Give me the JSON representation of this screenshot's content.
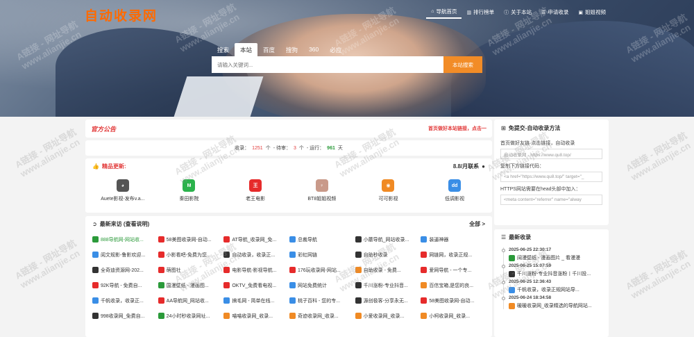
{
  "site": {
    "logo": "自动收录网"
  },
  "topnav": [
    {
      "icon": "home-icon",
      "glyph": "⌂",
      "label": "导航首页",
      "active": true
    },
    {
      "icon": "chart-icon",
      "glyph": "▥",
      "label": "排行榜单"
    },
    {
      "icon": "info-icon",
      "glyph": "ⓘ",
      "label": "关于本站"
    },
    {
      "icon": "feed-icon",
      "glyph": "☰",
      "label": "申请收录"
    },
    {
      "icon": "video-icon",
      "glyph": "▣",
      "label": "姐姐视频"
    }
  ],
  "search": {
    "tabs": [
      "搜索",
      "本站",
      "百度",
      "搜狗",
      "360",
      "必应"
    ],
    "active_tab": 1,
    "placeholder": "请输入关键词...",
    "button": "本站搜索"
  },
  "announcement": {
    "tag": "官方公告",
    "message": "首页做好本站链接，点击一"
  },
  "stats": {
    "label_total": "收录：",
    "total": "1251",
    "unit": "个",
    "label_pending": "- 待审：",
    "pending": "3",
    "unit2": "个",
    "label_days": "- 运行：",
    "days": "961",
    "unit3": "天"
  },
  "featured": {
    "title": "精品更新:",
    "right": "8.8/月联系",
    "items": [
      {
        "name": "Auete影视-发布v.a...",
        "icon": "cat-icon",
        "color": "#555555",
        "glyph": "◕"
      },
      {
        "name": "秦田影院",
        "icon": "mtyy-icon",
        "color": "#2bb24c",
        "glyph": "M"
      },
      {
        "name": "老王电影",
        "icon": "wang-icon",
        "color": "#e62b2b",
        "glyph": "王"
      },
      {
        "name": "BT8姐姐视频",
        "icon": "girl-icon",
        "color": "#c99a8a",
        "glyph": "♀"
      },
      {
        "name": "可可影视",
        "icon": "koko-icon",
        "color": "#f08a24",
        "glyph": "◉"
      },
      {
        "name": "低调影视",
        "icon": "dd-icon",
        "color": "#3a8ee6",
        "glyph": "dd"
      }
    ]
  },
  "visits": {
    "title": "最新来访 (查看说明)",
    "more": "全部 >",
    "items": [
      {
        "name": "888导航网-网站收...",
        "color": "#2b9a3a",
        "highlight": true
      },
      {
        "name": "58美图收录网-自动...",
        "color": "#e62b2b"
      },
      {
        "name": "AT导航_收录网_免...",
        "color": "#e62b2b"
      },
      {
        "name": "总裁导航",
        "color": "#3a8ee6"
      },
      {
        "name": "小蘑导航_网站收录...",
        "color": "#333333"
      },
      {
        "name": "装逼神器",
        "color": "#3a8ee6"
      },
      {
        "name": "阅文规影-鲁影欢迎...",
        "color": "#3a8ee6"
      },
      {
        "name": "小影看吧-免费为您...",
        "color": "#e62b2b"
      },
      {
        "name": "自动收录，收录正...",
        "color": "#333333"
      },
      {
        "name": "彩虹网链",
        "color": "#3a8ee6"
      },
      {
        "name": "自助秒收录",
        "color": "#333333"
      },
      {
        "name": "网链网，收录正规...",
        "color": "#e62b2b"
      },
      {
        "name": "全奇迪资源网-202...",
        "color": "#333333"
      },
      {
        "name": "萌图社",
        "color": "#e62b2b"
      },
      {
        "name": "电影导航-影视导航...",
        "color": "#e62b2b"
      },
      {
        "name": "176玩收录网-网站...",
        "color": "#e62b2b"
      },
      {
        "name": "自助收录 - 免费...",
        "color": "#f08a24"
      },
      {
        "name": "爱网导航 - 一个专...",
        "color": "#e62b2b"
      },
      {
        "name": "92K导航 - 免费自...",
        "color": "#e62b2b"
      },
      {
        "name": "国漫壁纸 - 漫画图...",
        "color": "#2b9a3a"
      },
      {
        "name": "OKTV_免费看电视...",
        "color": "#e62b2b"
      },
      {
        "name": "网站免费统计",
        "color": "#3a8ee6"
      },
      {
        "name": "千川涨粉-专业抖音...",
        "color": "#333333"
      },
      {
        "name": "百信宝箱,是您的良...",
        "color": "#f08a24"
      },
      {
        "name": "千帆收录，收录正...",
        "color": "#3a8ee6"
      },
      {
        "name": "AA导航网_网站收...",
        "color": "#e62b2b"
      },
      {
        "name": "搞毛网 - 简单在线...",
        "color": "#3a8ee6"
      },
      {
        "name": "桃子百科 - 您的专...",
        "color": "#3a8ee6"
      },
      {
        "name": "源创极客-分享永无...",
        "color": "#333333"
      },
      {
        "name": "58美图收录网-自动...",
        "color": "#e62b2b"
      },
      {
        "name": "998收录网_免费自...",
        "color": "#333333"
      },
      {
        "name": "24小时秒收录网址...",
        "color": "#2b9a3a"
      },
      {
        "name": "喵喵收录网_收录...",
        "color": "#f08a24"
      },
      {
        "name": "奇迹收录网_收录...",
        "color": "#f08a24"
      },
      {
        "name": "小爱收录网_收录...",
        "color": "#f08a24"
      },
      {
        "name": "小柯收录网_收录...",
        "color": "#f08a24"
      }
    ]
  },
  "submit": {
    "title": "免提交-自动收录方法",
    "line1": "首页做好友链·点击链接，自动收录",
    "input1": "自动收录网 - https://www.qu8.top/",
    "line2": "复制下方链接代码：",
    "input2": "<a href=\"https://www.qu8.top/\" target=\"_",
    "line3": "HTTPS网站需要在head头部中加入：",
    "input3": "<meta content=\"referrer\" name=\"alway"
  },
  "recent": {
    "title": "最新收录",
    "items": [
      {
        "time": "2025-06-25 22:30:17",
        "name": "阔漫壁纸 - 漫画图片 _ 看漫漫",
        "color": "#2b9a3a"
      },
      {
        "time": "2025-06-25 15:07:59",
        "name": "千川涨粉-专业抖音涨粉丨千川投...",
        "color": "#333333"
      },
      {
        "time": "2025-06-25 12:36:43",
        "name": "千帆收录，收录正规网站导...",
        "color": "#3a8ee6"
      },
      {
        "time": "2025-06-24 18:34:58",
        "name": "暖暖收录网_收录精选的导航网站...",
        "color": "#f08a24"
      }
    ]
  },
  "watermark": {
    "line1": "A链接 - 网址导航",
    "line2": "www.alianjie.cn"
  }
}
